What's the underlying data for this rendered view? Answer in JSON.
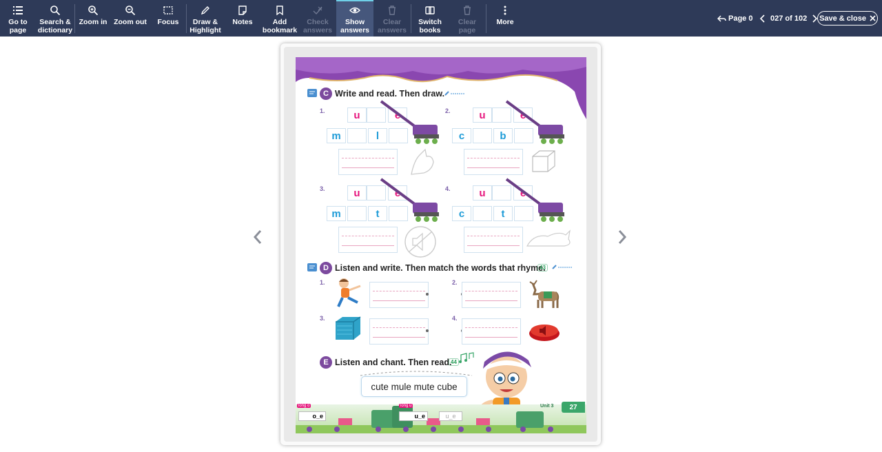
{
  "toolbar": {
    "go_to_page": "Go to\npage",
    "search": "Search &\ndictionary",
    "zoom_in": "Zoom in",
    "zoom_out": "Zoom out",
    "focus": "Focus",
    "draw": "Draw &\nHighlight",
    "notes": "Notes",
    "bookmark": "Add\nbookmark",
    "check": "Check\nanswers",
    "show": "Show\nanswers",
    "clear_answers": "Clear\nanswers",
    "switch": "Switch\nbooks",
    "clear_page": "Clear\npage",
    "more": "More"
  },
  "nav": {
    "page_label": "Page 0",
    "page_counter": "027 of 102",
    "save_close": "Save & close"
  },
  "page": {
    "section_c": {
      "letter": "C",
      "title": "Write and read. Then draw."
    },
    "items_c": [
      {
        "num": "1.",
        "top": [
          "u",
          "e"
        ],
        "bottom": [
          "m",
          "l"
        ]
      },
      {
        "num": "2.",
        "top": [
          "u",
          "e"
        ],
        "bottom": [
          "c",
          "b"
        ]
      },
      {
        "num": "3.",
        "top": [
          "u",
          "e"
        ],
        "bottom": [
          "m",
          "t"
        ]
      },
      {
        "num": "4.",
        "top": [
          "u",
          "e"
        ],
        "bottom": [
          "c",
          "t"
        ]
      }
    ],
    "section_d": {
      "letter": "D",
      "title": "Listen and write. Then match the words that rhyme.",
      "track": "43"
    },
    "items_d": [
      "1.",
      "2.",
      "3.",
      "4."
    ],
    "section_e": {
      "letter": "E",
      "title": "Listen and chant. Then read.",
      "track": "44"
    },
    "chant_text": "cute mule mute cube",
    "footer": {
      "long_o": "long o",
      "long_u": "long u",
      "o_e": "o_e",
      "u_e": "u_e",
      "u_e_blank": "u_e",
      "unit": "Unit 3",
      "page_num": "27"
    }
  },
  "colors": {
    "toolbar_bg": "#2e3a58",
    "accent": "#6fd0e8",
    "purple": "#7c4a9e",
    "pink": "#e6157d",
    "blue": "#1d9bd7"
  }
}
